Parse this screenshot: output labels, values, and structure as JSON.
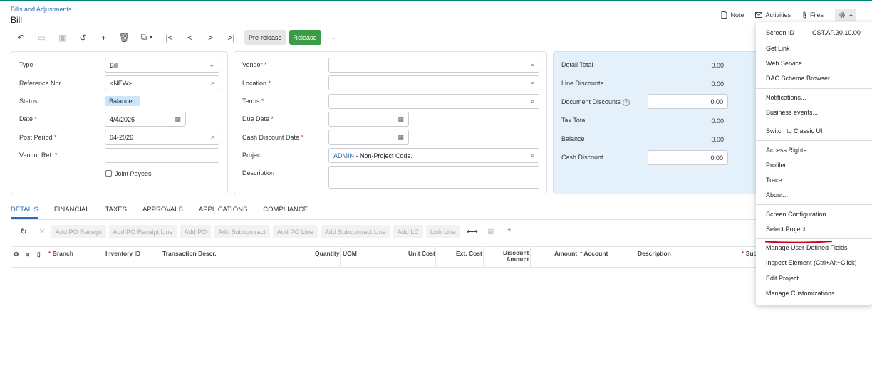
{
  "header": {
    "breadcrumb": "Bills and Adjustments",
    "title": "Bill",
    "links": [
      {
        "icon": "note-icon",
        "label": "Note"
      },
      {
        "icon": "mail-icon",
        "label": "Activities"
      },
      {
        "icon": "paperclip-icon",
        "label": "Files"
      }
    ]
  },
  "toolbar": {
    "prerelease_label": "Pre-release",
    "release_label": "Release",
    "more_label": "···",
    "release_color": "#3a9c45"
  },
  "left_panel": {
    "type_label": "Type",
    "type_value": "Bill",
    "ref_label": "Reference Nbr.",
    "ref_value": "<NEW>",
    "status_label": "Status",
    "status_value": "Balanced",
    "date_label": "Date",
    "date_value": "4/4/2026",
    "period_label": "Post Period",
    "period_value": "04-2026",
    "vendor_ref_label": "Vendor Ref.",
    "vendor_ref_value": "",
    "joint_payees_label": "Joint Payees",
    "required_mark": "*"
  },
  "mid_panel": {
    "vendor_label": "Vendor",
    "location_label": "Location",
    "terms_label": "Terms",
    "due_date_label": "Due Date",
    "cash_disc_date_label": "Cash Discount Date",
    "project_label": "Project",
    "project_code": "ADMIN",
    "project_desc": " - Non-Project Code.",
    "description_label": "Description"
  },
  "right_panel": {
    "detail_total_label": "Detail Total",
    "detail_total": "0.00",
    "line_discounts_label": "Line Discounts",
    "line_discounts": "0.00",
    "doc_discounts_label": "Document Discounts",
    "doc_discounts": "0.00",
    "tax_total_label": "Tax Total",
    "tax_total": "0.00",
    "balance_label": "Balance",
    "balance": "0.00",
    "cash_discount_label": "Cash Discount",
    "cash_discount": "0.00"
  },
  "tabs": [
    "DETAILS",
    "FINANCIAL",
    "TAXES",
    "APPROVALS",
    "APPLICATIONS",
    "COMPLIANCE"
  ],
  "grid_toolbar": [
    "Add PO Receipt",
    "Add PO Receipt Line",
    "Add PO",
    "Add Subcontract",
    "Add PO Line",
    "Add Subcontract Line",
    "Add LC",
    "Link Line"
  ],
  "grid_columns": {
    "branch": "Branch",
    "inventory": "Inventory ID",
    "trans_descr": "Transaction Descr.",
    "quantity": "Quantity",
    "uom": "UOM",
    "unit_cost": "Unit Cost",
    "ext_cost": "Ext. Cost",
    "disc_amount_1": "Discount",
    "disc_amount_2": "Amount",
    "amount": "Amount",
    "account": "Account",
    "description": "Description",
    "sub": "Sub"
  },
  "menu": {
    "screen_id_label": "Screen ID",
    "screen_id_value": "CST.AP.30.10.00",
    "items": [
      "Get Link",
      "Web Service",
      "DAC Schema Browser",
      "Notifications...",
      "Business events...",
      "Switch to Classic UI",
      "Access Rights...",
      "Profiler",
      "Trace...",
      "About...",
      "Screen Configuration",
      "Select Project...",
      "Manage User-Defined Fields",
      "Inspect Element (Ctrl+Alt+Click)",
      "Edit Project...",
      "Manage Customizations..."
    ],
    "highlight_color": "#d0021b"
  }
}
